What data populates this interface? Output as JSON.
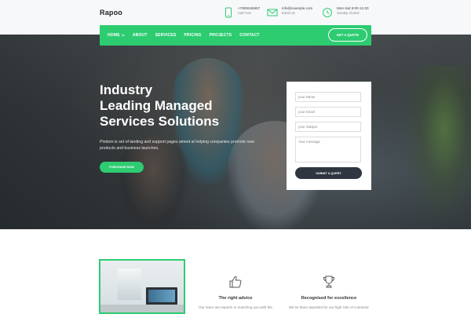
{
  "header": {
    "logo": "Rapoo",
    "contacts": [
      {
        "icon": "phone-icon",
        "main": "+7809346657",
        "sub": "Call Free"
      },
      {
        "icon": "mail-icon",
        "main": "info@example.com",
        "sub": "Email Us"
      },
      {
        "icon": "clock-icon",
        "main": "Mon-Sat 8:00-12.00",
        "sub": "Sunday Closed"
      }
    ]
  },
  "nav": {
    "items": [
      "HOME",
      "ABOUT",
      "SERVICES",
      "PRICING",
      "PROJECTS",
      "CONTACT"
    ],
    "cta": "GET A QUOTE"
  },
  "hero": {
    "title_line1": "Industry",
    "title_line2": "Leading Managed",
    "title_line3": "Services Solutions",
    "description": "Pindom is set of landing and support pages aimed at helping companies promote new products and business launches.",
    "button": "PURCHASE NOW"
  },
  "quote_form": {
    "name_placeholder": "your Name",
    "email_placeholder": "your Email",
    "subject_placeholder": "your Subject",
    "message_placeholder": "Your message",
    "submit": "SUBMIT A QUERY"
  },
  "features": [
    {
      "icon": "thumbs-up-icon",
      "title": "The right advice",
      "text": "Our team are experts in matching you with the"
    },
    {
      "icon": "trophy-icon",
      "title": "Recognised for excellence",
      "text": "We've been awarded for our high rate of customer"
    }
  ],
  "colors": {
    "accent": "#2ecc71",
    "dark_button": "#2f3640"
  }
}
